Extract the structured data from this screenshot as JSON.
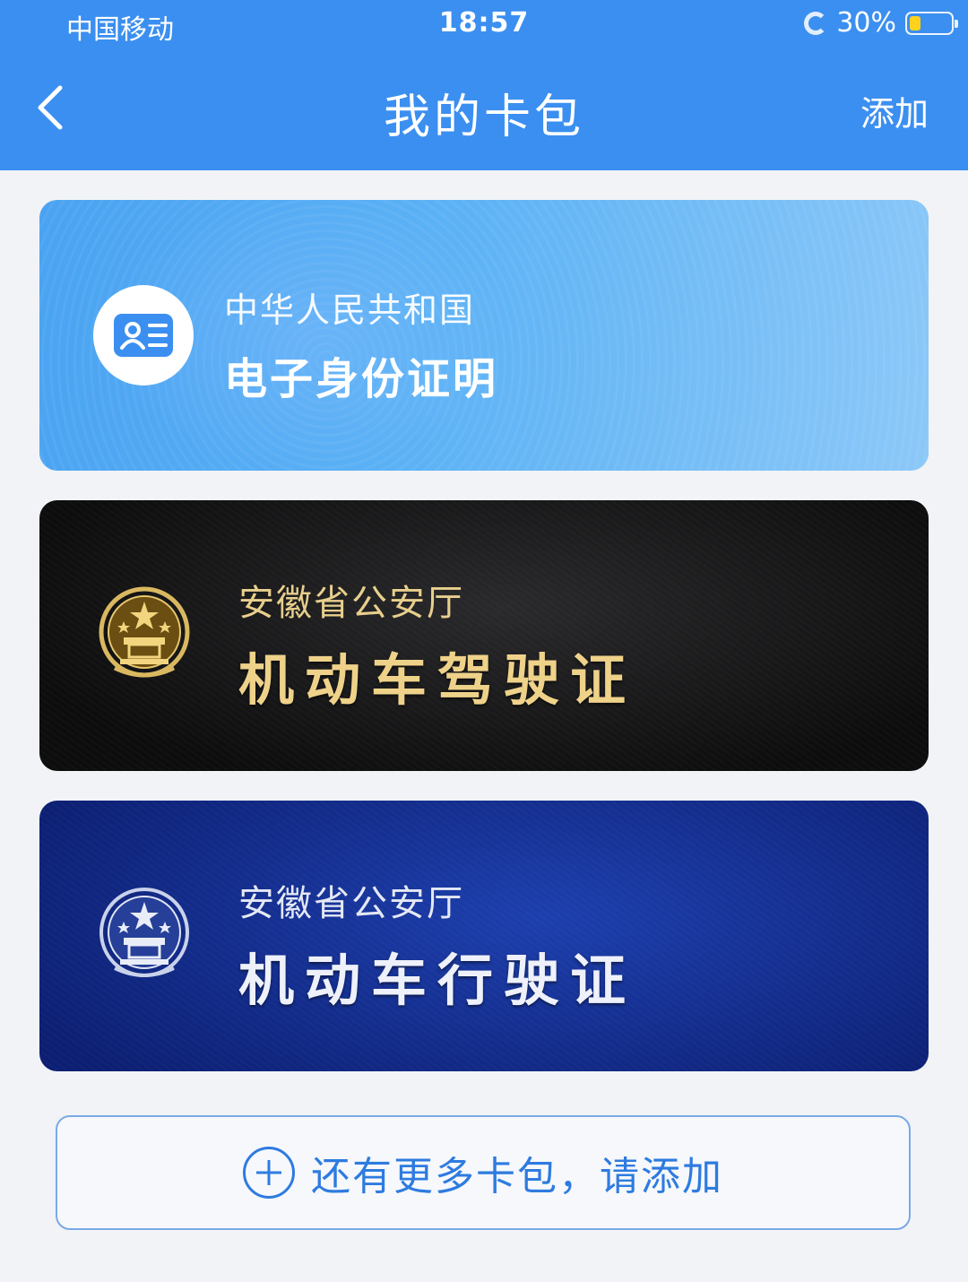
{
  "status_bar": {
    "carrier": "中国移动",
    "time": "18:57",
    "battery": "30%",
    "signal_icon": "signal-icon",
    "battery_icon": "battery-icon"
  },
  "header": {
    "title": "我的卡包",
    "add_label": "添加",
    "back_icon": "chevron-left-icon",
    "background_color": "#3b8ff0"
  },
  "cards": [
    {
      "subtitle": "中华人民共和国",
      "title": "电子身份证明",
      "icon": "id-card-icon",
      "color": "#5cb2f5"
    },
    {
      "subtitle": "安徽省公安厅",
      "title": "机动车驾驶证",
      "icon": "national-emblem-icon",
      "color": "#111112"
    },
    {
      "subtitle": "安徽省公安厅",
      "title": "机动车行驶证",
      "icon": "national-emblem-icon",
      "color": "#12298a"
    }
  ],
  "add_more": {
    "label": "还有更多卡包，请添加",
    "icon": "plus-circle-icon",
    "color": "#2e7be0"
  }
}
